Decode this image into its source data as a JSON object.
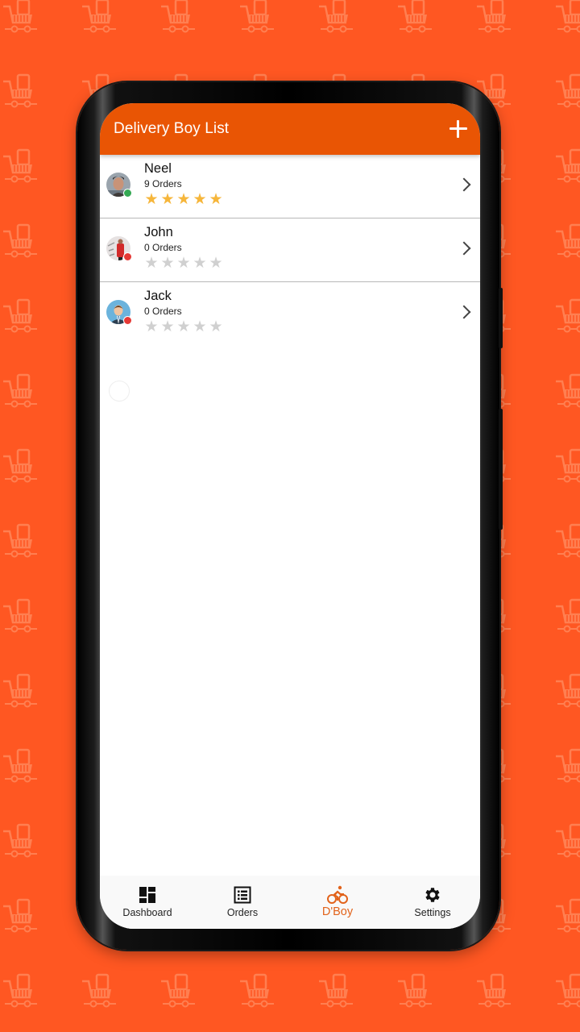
{
  "theme": {
    "accent": "#e95504",
    "background": "#ff5722",
    "active_nav": "#e2631b",
    "star_filled": "#f6b63b",
    "star_empty": "#d0d0d0",
    "online": "#34a853",
    "offline": "#e53935"
  },
  "appbar": {
    "title": "Delivery Boy List",
    "add_icon": "plus-icon"
  },
  "delivery_boys": [
    {
      "name": "Neel",
      "orders": "9 Orders",
      "rating": 5,
      "max_rating": 5,
      "status": "online",
      "chevron_icon": "chevron-right-icon"
    },
    {
      "name": "John",
      "orders": "0 Orders",
      "rating": 0,
      "max_rating": 5,
      "status": "offline",
      "chevron_icon": "chevron-right-icon"
    },
    {
      "name": "Jack",
      "orders": "0 Orders",
      "rating": 0,
      "max_rating": 5,
      "status": "offline",
      "chevron_icon": "chevron-right-icon"
    }
  ],
  "bottom_nav": [
    {
      "label": "Dashboard",
      "icon": "dashboard-icon",
      "active": false
    },
    {
      "label": "Orders",
      "icon": "orders-list-icon",
      "active": false
    },
    {
      "label": "D'Boy",
      "icon": "bicycle-icon",
      "active": true
    },
    {
      "label": "Settings",
      "icon": "gear-icon",
      "active": false
    }
  ]
}
